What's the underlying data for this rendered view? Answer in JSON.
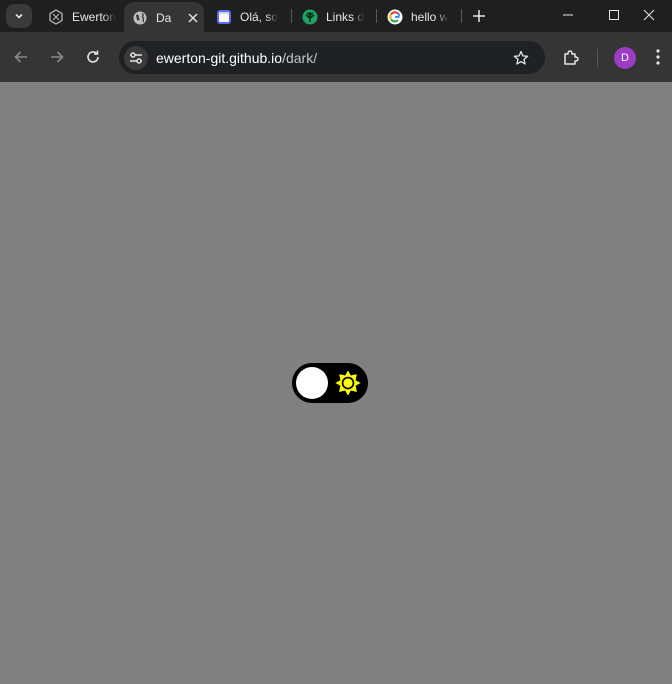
{
  "browser": {
    "tabs": [
      {
        "title": "Ewerton",
        "icon": "logo-icon",
        "active": false
      },
      {
        "title": "Da",
        "icon": "globe-icon",
        "active": true
      },
      {
        "title": "Olá, so",
        "icon": "calendar-icon",
        "active": false
      },
      {
        "title": "Links d",
        "icon": "linktree-icon",
        "active": false
      },
      {
        "title": "hello w",
        "icon": "google-icon",
        "active": false
      }
    ],
    "url": {
      "host": "ewerton-git.github.io",
      "path": "/dark/"
    },
    "profile_initial": "D"
  },
  "page": {
    "background": "#808080",
    "toggle": {
      "state": "off",
      "knob_color": "#ffffff",
      "track_color": "#000000",
      "sun_color": "#ffff00"
    }
  }
}
